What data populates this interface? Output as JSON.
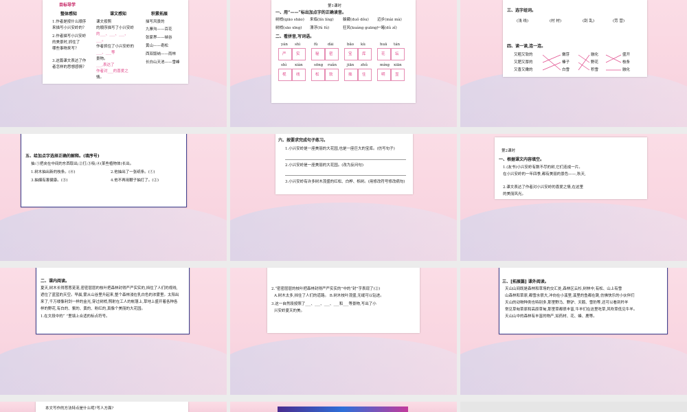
{
  "t1": {
    "tag": "目标导学",
    "col1_title": "整体感知",
    "col2_title": "课文感知",
    "col3_title": "积累拓展",
    "col1_lines": [
      "1.作者是按什么顺序",
      "来描写小兴安岭的？",
      "2.作者描写小兴安岭",
      "的美景时,抓住了",
      "哪些事物来写？",
      "3.这篇课文表达了作",
      "者怎样的思想感情？"
    ],
    "col2_lines": [
      "课文按照",
      "的顺序描写了小兴安岭",
      "的___、___、___、",
      "___。",
      "作者抓住了小兴安岭的",
      "___、___等",
      "景物。",
      "___,表达了",
      "作者对___的喜爱之",
      "情。"
    ],
    "col3_lines": [
      "描写风景的",
      "九寨沟——百花",
      "张家界——峡谷",
      "黄山——奇松",
      "西双版纳——雨林",
      "长白山天池——雪峰"
    ]
  },
  "t2": {
    "heading": "第1课时",
    "q1": "一、用“——”标出加点字的正确读音。",
    "row1": [
      "树梢(qiāo  shāo)",
      "来临(lín  líng)",
      "躲藏(duǒ  dǒu)",
      "迈步(mài  mà)"
    ],
    "row2": [
      "树梢(sāo  xīng)",
      "漂浮(fú  fú)",
      "狂风(kuáng  guāng)",
      "一睹(dǔ  zǐ)"
    ],
    "q2": "二、看拼音,写词语。",
    "pinyin1": [
      "yán",
      "shì",
      "fù",
      "dài",
      "bǎo",
      "kù",
      "huā",
      "tán"
    ],
    "words1": [
      "严",
      "实",
      "秘",
      "密",
      "宝",
      "库",
      "花",
      "坛"
    ],
    "pinyin2": [
      "shì",
      "xiàn",
      "sōng",
      "ruǎn",
      "jiān",
      "zhǔ",
      "míng",
      "xiān"
    ],
    "words2": [
      "视",
      "线",
      "松",
      "软",
      "拙",
      "住",
      "明",
      "显"
    ]
  },
  "t3": {
    "q3": "三、选字组词。",
    "choices": [
      "(浅 线)",
      "(村 材)",
      "(刮 乱)",
      "(劳 营)"
    ],
    "q4": "四、读一读,连一连。",
    "left": [
      "又粗又软的",
      "又肥又厚的",
      "又香又嫩的"
    ],
    "mid": [
      "嫩芽",
      "榛子",
      "白雪"
    ],
    "right": [
      "融化",
      "野花",
      "积雪"
    ],
    "far": [
      "盛开",
      "枝条",
      "融化"
    ]
  },
  "t4": {
    "q5": "五、给加点字选择正确的解释。(填序号)",
    "def": "抽:①把夹在中间的东西取出;②打;③吸;④(某些植物体)长出。",
    "items": [
      "1.树木抽出新的枝条。(④)",
      "2.他抽出了一张纸条。(①)",
      "3.抽烟有害健康。(③)",
      "4.他不再用鞭子抽打了。(②)"
    ]
  },
  "t5": {
    "q6": "六、按要求完成句子练习。",
    "s1": "1.小兴安岭是一座美丽的大花园,也是一座巨大的宝库。(仿写句子)",
    "s2": "2.小兴安岭是一座美丽的大花园。(改为反问句)",
    "s3": "3.小兴安岭有许多树木茂盛的红松、白桦、栎树。(用修改符号修改病句)"
  },
  "t6": {
    "heading": "第2课时",
    "q1": "一、根据课文内容填空。",
    "lines": [
      "1.(友书)小兴安岭有数不尽的树,它们连成一片。",
      "在小兴安岭的一年四季,都有美丽的景色——,秋天,",
      "2.课文表达了作者对小兴安岭的喜爱之情,在这里",
      "的美丽风光。"
    ]
  },
  "t7": {
    "q2": "二、课内阅读。",
    "lines": [
      "夏天,树木长得葱葱茏茏,密密层层的枝叶把森林封得严严实实的,挡住了人们的视线,",
      "遮住了蓝蓝的天空。早晨,雾从山谷里升起来,整个森林浸在乳白色的浓雾里。太阳出",
      "来了,千万缕像利剑一样的金光,穿过树梢,照射在工人的帐篷上,草地上盛开着各种各",
      "样的野花,有白的、紫的、黄的、粉红的,真像个美丽的大花园。",
      "1.在文段中的“ ”里填上合适的标点符号。"
    ]
  },
  "t8": {
    "lines": [
      "2.“密密层层的枝叶把森林封得严严实实的”中的“封”字表现了(②)",
      "A.树木太多,挡住了人们的道路。  B.树木枝叶茂盛,无缝可以钻进。",
      "3.这一自然段按照了___、___、___、___和___等景物,写出了小",
      "兴安岭夏天的美。"
    ]
  },
  "t9": {
    "q3": "三、[拓展篇] 课外阅读。",
    "lines": [
      "天山山间既是森林和草场的交汇处,森林区云杉,树林中,有松、山上有雪",
      "山森林和草原,都雪水很大,冲向在小溪里,溪里的鱼都在跳,仿佛快乐的小伙伴们",
      "天山的动物种类也特别多,那里野马、野驴、天鹅、雪豹等,还可以看到羚羊",
      "常见草甸草原和高原草甸,那里草都很丰富,牛羊们在这里吃草,风吹草低见牛羊。",
      "天山山中的森林有丰富的物产,如药材、花、蜂、鹿等。"
    ]
  },
  "t10": {
    "line": "本文写作的方法特点是什么呢?写人方面?"
  }
}
